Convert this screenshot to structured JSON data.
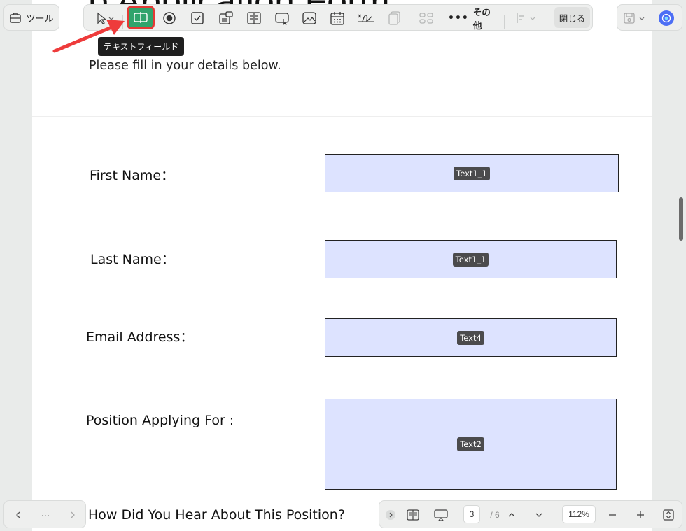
{
  "document": {
    "title": "b Application Form",
    "subtitle": "Please fill in your details below.",
    "fields": [
      {
        "label": "First Name：",
        "tag": "Text1_1"
      },
      {
        "label": "Last Name：",
        "tag": "Text1_1"
      },
      {
        "label": "Email Address：",
        "tag": "Text4"
      },
      {
        "label": "Position Applying For :",
        "tag": "Text2"
      }
    ],
    "trailing_label": "How Did You Hear About This Position?"
  },
  "toolbar": {
    "tools_label": "ツール",
    "more_label": "その他",
    "close_label": "閉じる",
    "tooltip": "テキストフィールド",
    "items": [
      "select-tool",
      "text-field",
      "radio-button",
      "checkbox",
      "combo-box",
      "list-box",
      "button",
      "image",
      "date",
      "signature",
      "duplicate",
      "grid"
    ]
  },
  "pager": {
    "more": "···",
    "current_page": "3",
    "total_pages": "/ 6",
    "zoom": "112%"
  },
  "colors": {
    "field_fill": "#dde3ff",
    "active_tool": "#30a46c",
    "highlight_border": "#e53935",
    "arrow": "#ee3b3b"
  }
}
